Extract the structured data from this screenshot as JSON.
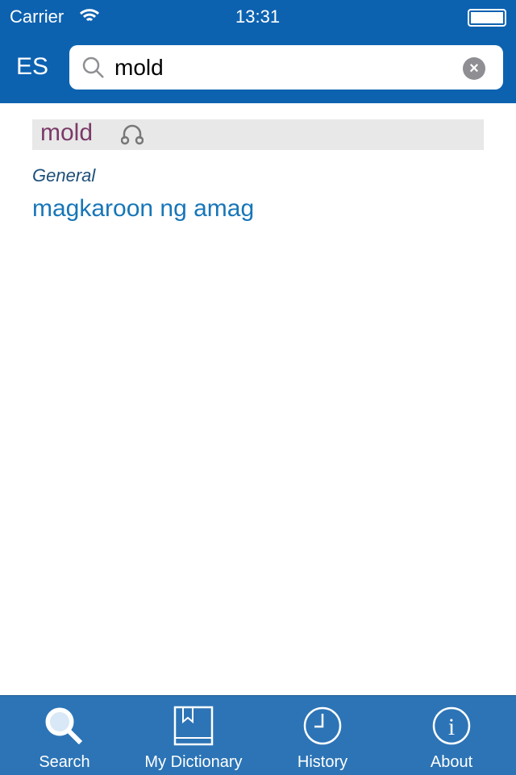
{
  "status": {
    "carrier": "Carrier",
    "time": "13:31"
  },
  "header": {
    "lang": "ES",
    "search_value": "mold"
  },
  "entry": {
    "word": "mold",
    "category": "General",
    "translation": "magkaroon ng amag"
  },
  "tabs": [
    {
      "label": "Search",
      "icon": "search-icon"
    },
    {
      "label": "My Dictionary",
      "icon": "book-icon"
    },
    {
      "label": "History",
      "icon": "clock-icon"
    },
    {
      "label": "About",
      "icon": "info-icon"
    }
  ]
}
